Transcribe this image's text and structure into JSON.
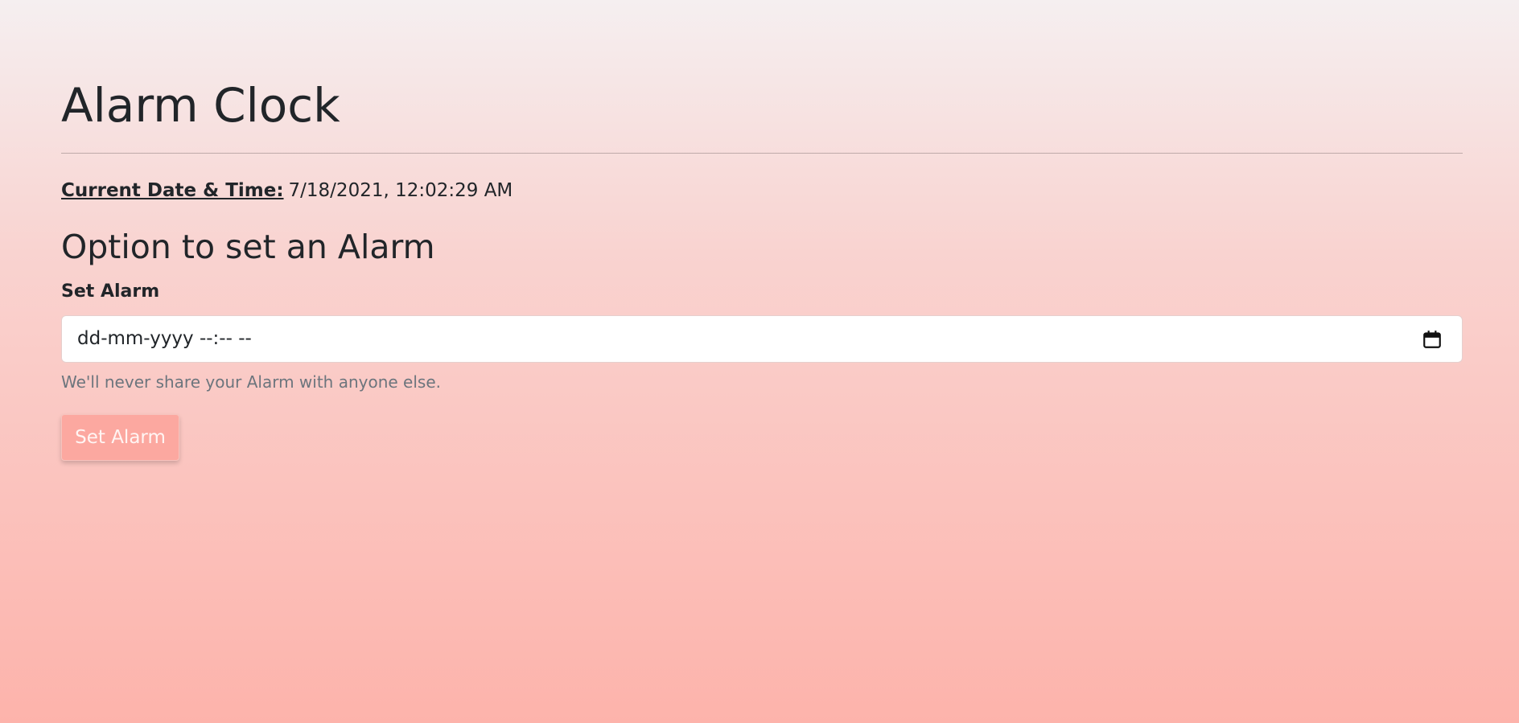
{
  "header": {
    "title": "Alarm Clock"
  },
  "current_datetime": {
    "label": "Current Date & Time:",
    "value": "7/18/2021, 12:02:29 AM"
  },
  "alarm_section": {
    "title": "Option to set an Alarm",
    "field_label": "Set Alarm",
    "input_placeholder": "dd-mm-yyyy --:-- --",
    "input_icon": "calendar-icon",
    "help_text": "We'll never share your Alarm with anyone else.",
    "button_label": "Set Alarm"
  },
  "colors": {
    "background_top": "#f5eff0",
    "background_bottom": "#fdb3ab",
    "button": "#fca8a0",
    "help_text": "#6c757d",
    "text": "#212529"
  }
}
